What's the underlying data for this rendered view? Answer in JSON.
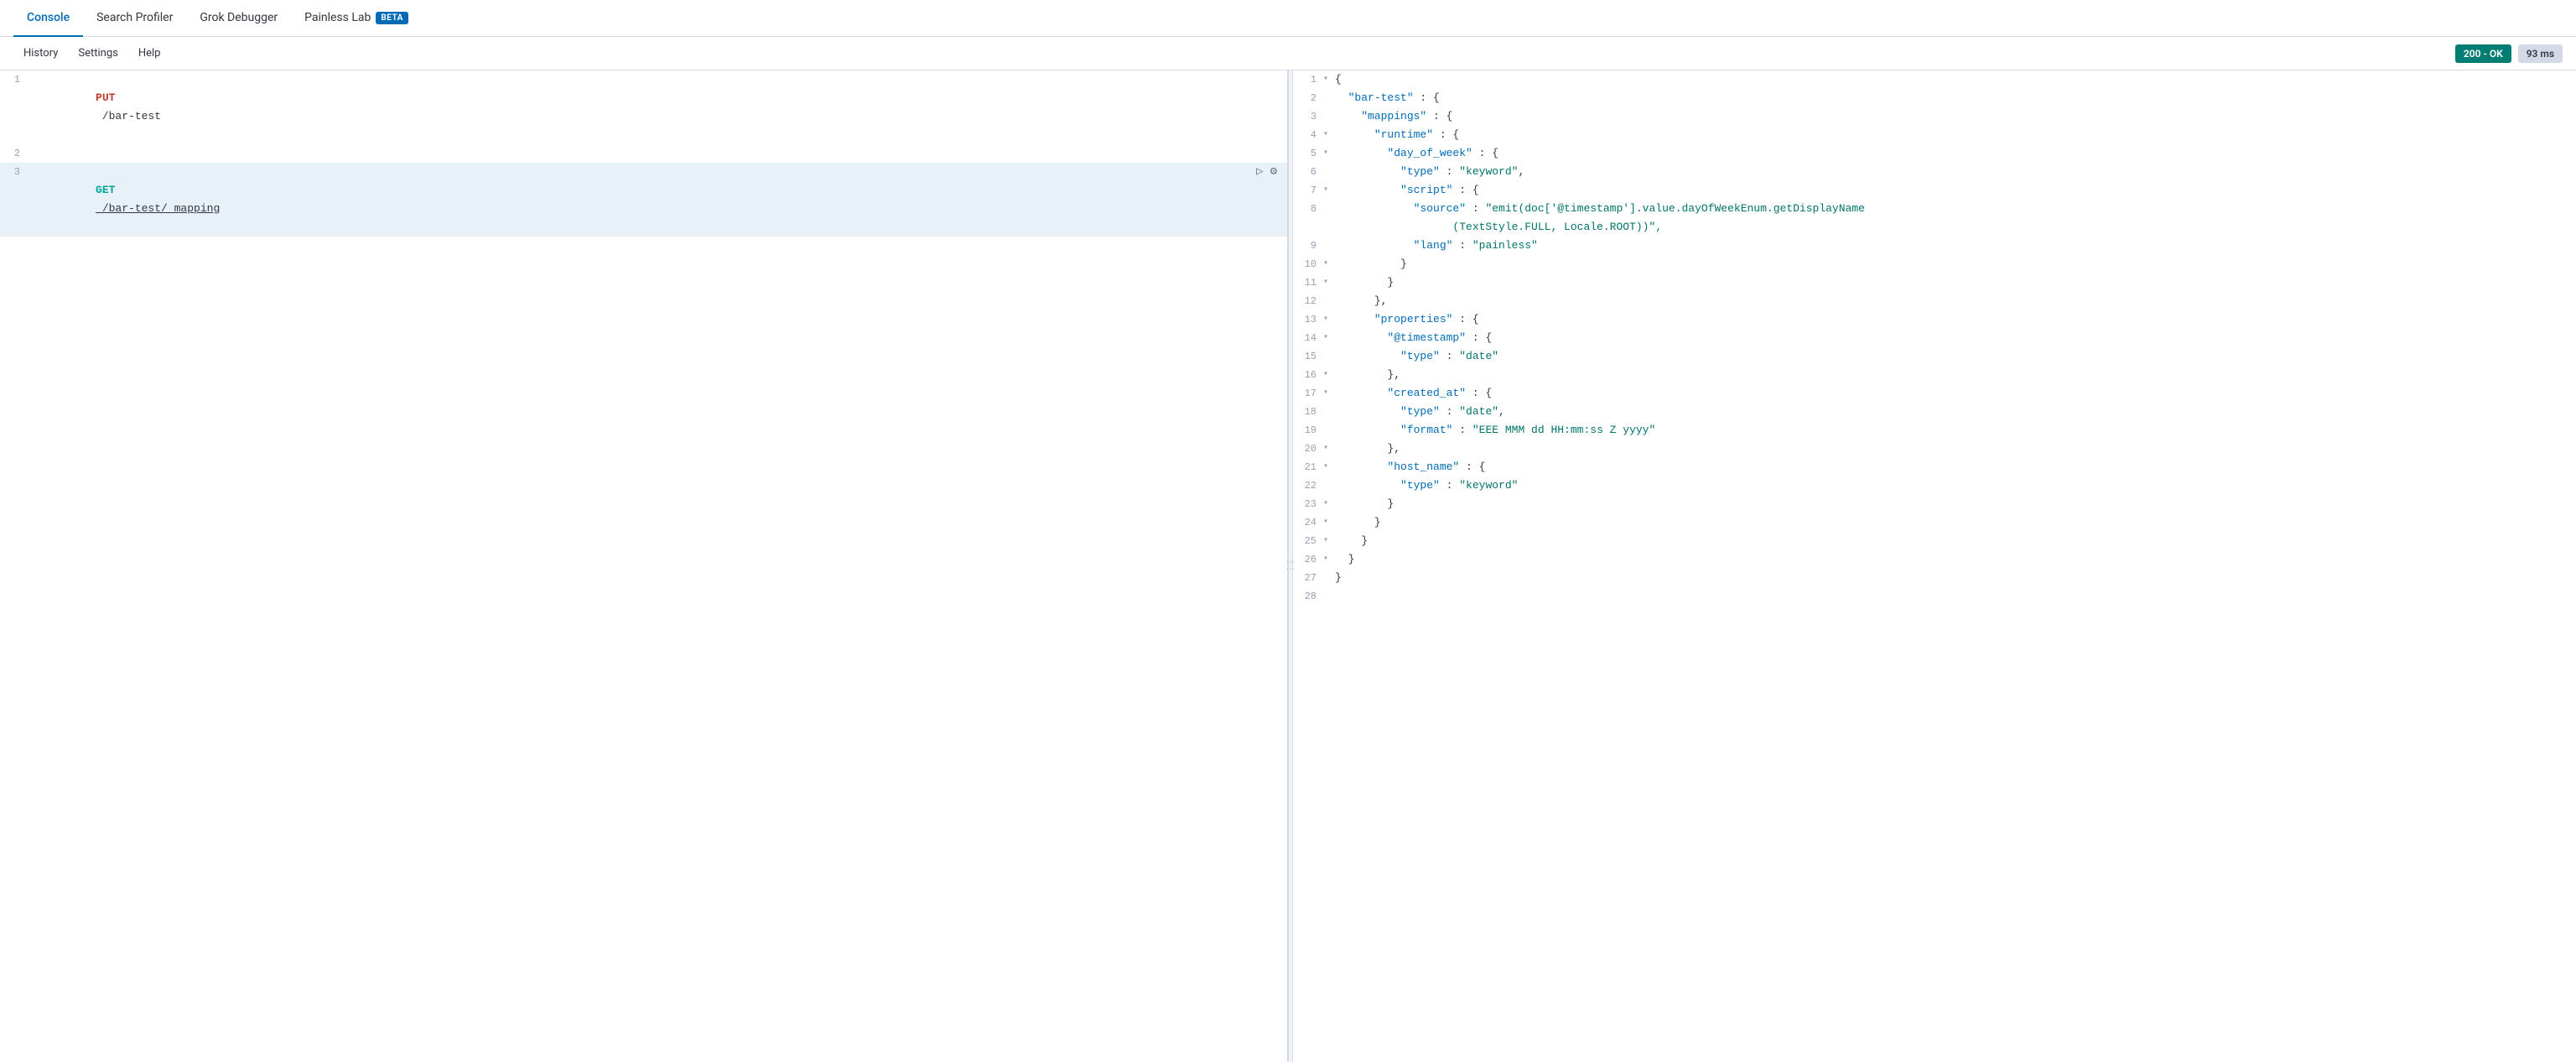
{
  "nav": {
    "tabs": [
      {
        "id": "console",
        "label": "Console",
        "active": true,
        "beta": false
      },
      {
        "id": "search-profiler",
        "label": "Search Profiler",
        "active": false,
        "beta": false
      },
      {
        "id": "grok-debugger",
        "label": "Grok Debugger",
        "active": false,
        "beta": false
      },
      {
        "id": "painless-lab",
        "label": "Painless Lab",
        "active": false,
        "beta": true
      }
    ]
  },
  "toolbar": {
    "history_label": "History",
    "settings_label": "Settings",
    "help_label": "Help",
    "status_label": "200 - OK",
    "time_label": "93 ms"
  },
  "editor": {
    "lines": [
      {
        "number": 1,
        "method": "PUT",
        "path": "/bar-test",
        "active": false,
        "has_actions": false
      },
      {
        "number": 2,
        "method": "",
        "path": "",
        "active": false,
        "has_actions": false
      },
      {
        "number": 3,
        "method": "GET",
        "path": "/bar-test/_mapping",
        "active": true,
        "has_actions": true
      }
    ]
  },
  "response": {
    "lines": [
      {
        "number": 1,
        "fold": true,
        "content": "{",
        "tokens": [
          {
            "type": "brace",
            "text": "{"
          }
        ]
      },
      {
        "number": 2,
        "fold": false,
        "content": "  \"bar-test\" : {",
        "tokens": [
          {
            "type": "indent",
            "text": "  "
          },
          {
            "type": "key",
            "text": "\"bar-test\""
          },
          {
            "type": "brace",
            "text": " : {"
          }
        ]
      },
      {
        "number": 3,
        "fold": false,
        "content": "    \"mappings\" : {",
        "tokens": [
          {
            "type": "indent",
            "text": "    "
          },
          {
            "type": "key",
            "text": "\"mappings\""
          },
          {
            "type": "brace",
            "text": " : {"
          }
        ]
      },
      {
        "number": 4,
        "fold": true,
        "content": "      \"runtime\" : {",
        "tokens": [
          {
            "type": "indent",
            "text": "      "
          },
          {
            "type": "key",
            "text": "\"runtime\""
          },
          {
            "type": "brace",
            "text": " : {"
          }
        ]
      },
      {
        "number": 5,
        "fold": true,
        "content": "        \"day_of_week\" : {",
        "tokens": [
          {
            "type": "indent",
            "text": "        "
          },
          {
            "type": "key",
            "text": "\"day_of_week\""
          },
          {
            "type": "brace",
            "text": " : {"
          }
        ]
      },
      {
        "number": 6,
        "fold": false,
        "content": "          \"type\" : \"keyword\",",
        "tokens": [
          {
            "type": "indent",
            "text": "          "
          },
          {
            "type": "key",
            "text": "\"type\""
          },
          {
            "type": "colon",
            "text": " : "
          },
          {
            "type": "string",
            "text": "\"keyword\""
          },
          {
            "type": "brace",
            "text": ","
          }
        ]
      },
      {
        "number": 7,
        "fold": true,
        "content": "          \"script\" : {",
        "tokens": [
          {
            "type": "indent",
            "text": "          "
          },
          {
            "type": "key",
            "text": "\"script\""
          },
          {
            "type": "brace",
            "text": " : {"
          }
        ]
      },
      {
        "number": 8,
        "fold": false,
        "content": "            \"source\" : \"emit(doc['@timestamp'].value.dayOfWeekEnum.getDisplayName(TextStyle.FULL, Locale.ROOT))\",",
        "tokens": [
          {
            "type": "indent",
            "text": "            "
          },
          {
            "type": "key",
            "text": "\"source\""
          },
          {
            "type": "colon",
            "text": " : "
          },
          {
            "type": "string",
            "text": "\"emit(doc['@timestamp'].value.dayOfWeekEnum.getDisplayName(TextStyle.FULL, Locale.ROOT))\","
          }
        ]
      },
      {
        "number": 9,
        "fold": false,
        "content": "            \"lang\" : \"painless\"",
        "tokens": [
          {
            "type": "indent",
            "text": "            "
          },
          {
            "type": "key",
            "text": "\"lang\""
          },
          {
            "type": "colon",
            "text": " : "
          },
          {
            "type": "string",
            "text": "\"painless\""
          }
        ]
      },
      {
        "number": 10,
        "fold": false,
        "content": "          }",
        "tokens": [
          {
            "type": "indent",
            "text": "          "
          },
          {
            "type": "brace",
            "text": "}"
          }
        ]
      },
      {
        "number": 11,
        "fold": false,
        "content": "        }",
        "tokens": [
          {
            "type": "indent",
            "text": "        "
          },
          {
            "type": "brace",
            "text": "}"
          }
        ]
      },
      {
        "number": 12,
        "fold": false,
        "content": "      },",
        "tokens": [
          {
            "type": "indent",
            "text": "      "
          },
          {
            "type": "brace",
            "text": "},"
          }
        ]
      },
      {
        "number": 13,
        "fold": true,
        "content": "      \"properties\" : {",
        "tokens": [
          {
            "type": "indent",
            "text": "      "
          },
          {
            "type": "key",
            "text": "\"properties\""
          },
          {
            "type": "brace",
            "text": " : {"
          }
        ]
      },
      {
        "number": 14,
        "fold": true,
        "content": "        \"@timestamp\" : {",
        "tokens": [
          {
            "type": "indent",
            "text": "        "
          },
          {
            "type": "key",
            "text": "\"@timestamp\""
          },
          {
            "type": "brace",
            "text": " : {"
          }
        ]
      },
      {
        "number": 15,
        "fold": false,
        "content": "          \"type\" : \"date\"",
        "tokens": [
          {
            "type": "indent",
            "text": "          "
          },
          {
            "type": "key",
            "text": "\"type\""
          },
          {
            "type": "colon",
            "text": " : "
          },
          {
            "type": "string",
            "text": "\"date\""
          }
        ]
      },
      {
        "number": 16,
        "fold": false,
        "content": "        },",
        "tokens": [
          {
            "type": "indent",
            "text": "        "
          },
          {
            "type": "brace",
            "text": "},"
          }
        ]
      },
      {
        "number": 17,
        "fold": true,
        "content": "        \"created_at\" : {",
        "tokens": [
          {
            "type": "indent",
            "text": "        "
          },
          {
            "type": "key",
            "text": "\"created_at\""
          },
          {
            "type": "brace",
            "text": " : {"
          }
        ]
      },
      {
        "number": 18,
        "fold": false,
        "content": "          \"type\" : \"date\",",
        "tokens": [
          {
            "type": "indent",
            "text": "          "
          },
          {
            "type": "key",
            "text": "\"type\""
          },
          {
            "type": "colon",
            "text": " : "
          },
          {
            "type": "string",
            "text": "\"date\""
          },
          {
            "type": "brace",
            "text": ","
          }
        ]
      },
      {
        "number": 19,
        "fold": false,
        "content": "          \"format\" : \"EEE MMM dd HH:mm:ss Z yyyy\"",
        "tokens": [
          {
            "type": "indent",
            "text": "          "
          },
          {
            "type": "key",
            "text": "\"format\""
          },
          {
            "type": "colon",
            "text": " : "
          },
          {
            "type": "string",
            "text": "\"EEE MMM dd HH:mm:ss Z yyyy\""
          }
        ]
      },
      {
        "number": 20,
        "fold": false,
        "content": "        },",
        "tokens": [
          {
            "type": "indent",
            "text": "        "
          },
          {
            "type": "brace",
            "text": "},"
          }
        ]
      },
      {
        "number": 21,
        "fold": true,
        "content": "        \"host_name\" : {",
        "tokens": [
          {
            "type": "indent",
            "text": "        "
          },
          {
            "type": "key",
            "text": "\"host_name\""
          },
          {
            "type": "brace",
            "text": " : {"
          }
        ]
      },
      {
        "number": 22,
        "fold": false,
        "content": "          \"type\" : \"keyword\"",
        "tokens": [
          {
            "type": "indent",
            "text": "          "
          },
          {
            "type": "key",
            "text": "\"type\""
          },
          {
            "type": "colon",
            "text": " : "
          },
          {
            "type": "string",
            "text": "\"keyword\""
          }
        ]
      },
      {
        "number": 23,
        "fold": false,
        "content": "        }",
        "tokens": [
          {
            "type": "indent",
            "text": "        "
          },
          {
            "type": "brace",
            "text": "}"
          }
        ]
      },
      {
        "number": 24,
        "fold": false,
        "content": "      }",
        "tokens": [
          {
            "type": "indent",
            "text": "      "
          },
          {
            "type": "brace",
            "text": "}"
          }
        ]
      },
      {
        "number": 25,
        "fold": false,
        "content": "    }",
        "tokens": [
          {
            "type": "indent",
            "text": "    "
          },
          {
            "type": "brace",
            "text": "}"
          }
        ]
      },
      {
        "number": 26,
        "fold": false,
        "content": "  }",
        "tokens": [
          {
            "type": "indent",
            "text": "  "
          },
          {
            "type": "brace",
            "text": "}"
          }
        ]
      },
      {
        "number": 27,
        "fold": false,
        "content": "}",
        "tokens": [
          {
            "type": "brace",
            "text": "}"
          }
        ]
      },
      {
        "number": 28,
        "fold": false,
        "content": "",
        "tokens": []
      }
    ]
  },
  "icons": {
    "run": "▷",
    "wrench": "🔧",
    "divider": "⋮⋮"
  }
}
